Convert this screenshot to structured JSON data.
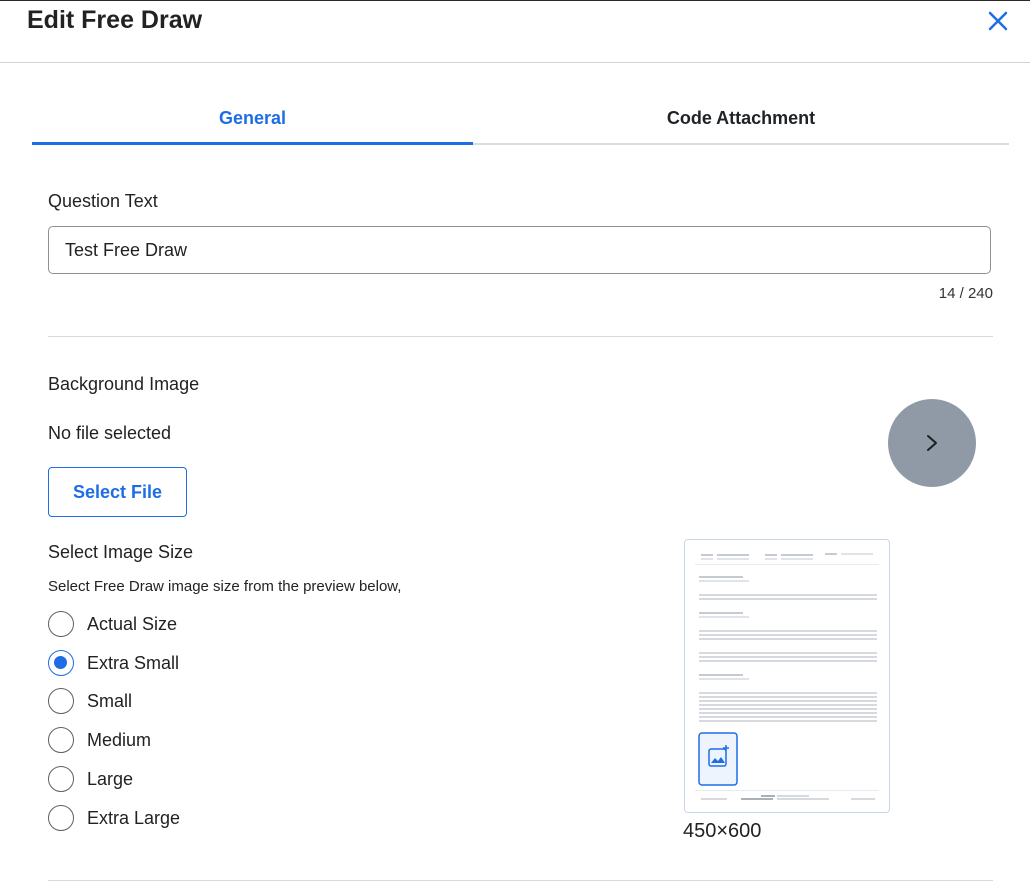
{
  "dialog": {
    "title": "Edit Free Draw",
    "close_icon": "close-icon"
  },
  "tabs": [
    {
      "label": "General",
      "active": true
    },
    {
      "label": "Code Attachment",
      "active": false
    }
  ],
  "question": {
    "label": "Question Text",
    "value": "Test Free Draw",
    "counter": "14 / 240"
  },
  "background_image": {
    "label": "Background Image",
    "status": "No file selected",
    "select_button": "Select File"
  },
  "image_size": {
    "label": "Select Image Size",
    "hint": "Select Free Draw image size from the preview below,",
    "selected": "Extra Small",
    "options": [
      {
        "label": "Actual Size",
        "checked": false
      },
      {
        "label": "Extra Small",
        "checked": true
      },
      {
        "label": "Small",
        "checked": false
      },
      {
        "label": "Medium",
        "checked": false
      },
      {
        "label": "Large",
        "checked": false
      },
      {
        "label": "Extra Large",
        "checked": false
      }
    ],
    "preview_dimensions": "450×600"
  },
  "colors": {
    "accent": "#1f6de5",
    "next_button": "#8f9aa6"
  }
}
